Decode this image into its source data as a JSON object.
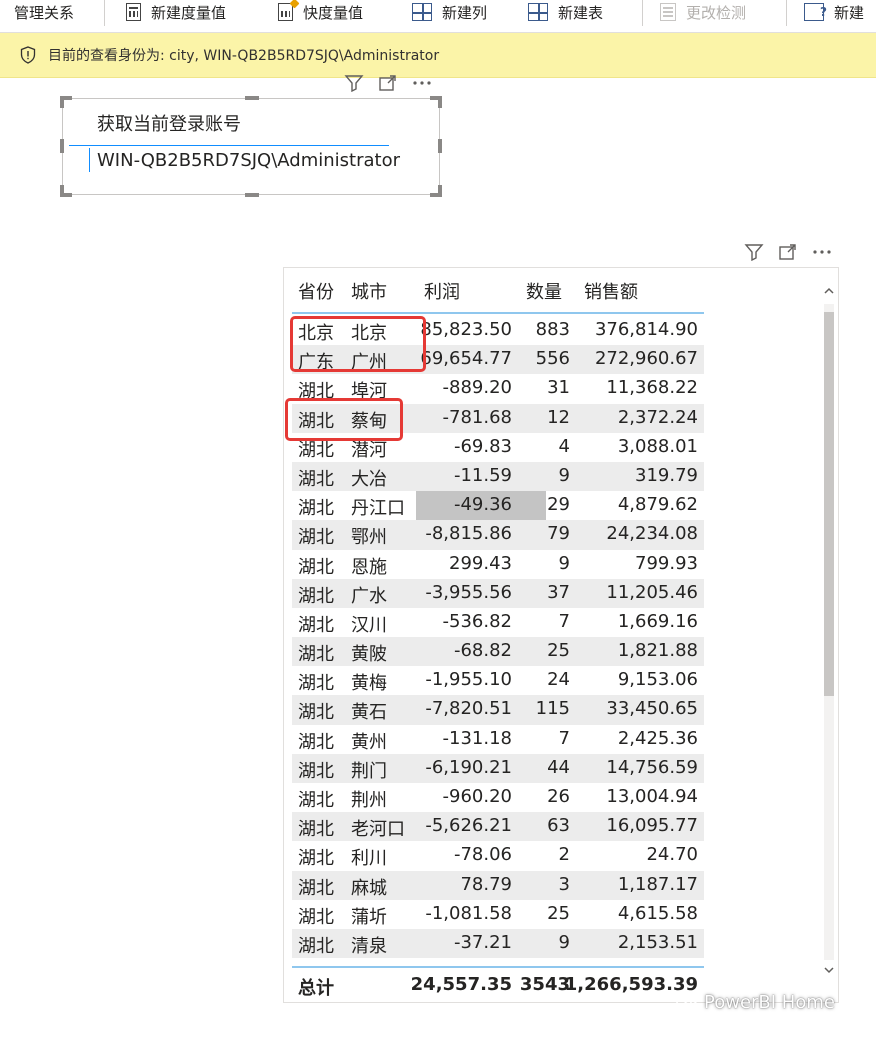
{
  "ribbon": {
    "items": [
      {
        "label": "管理关系",
        "icon": "manage-relationships-icon"
      },
      {
        "label": "新建度量值",
        "icon": "new-measure-icon"
      },
      {
        "label": "快度量值",
        "icon": "quick-measure-icon"
      },
      {
        "label": "新建列",
        "icon": "new-column-icon"
      },
      {
        "label": "新建表",
        "icon": "new-table-icon"
      },
      {
        "label": "更改检测",
        "icon": "change-detection-icon",
        "disabled": true
      },
      {
        "label": "新建",
        "icon": "new-parameter-icon"
      }
    ]
  },
  "notification": {
    "text": "目前的查看身份为: city, WIN-QB2B5RD7SJQ\\Administrator"
  },
  "card": {
    "title": "获取当前登录账号",
    "value": "WIN-QB2B5RD7SJQ\\Administrator"
  },
  "table": {
    "headers": {
      "province": "省份",
      "city": "城市",
      "profit": "利润",
      "quantity": "数量",
      "sales": "销售额"
    },
    "rows": [
      {
        "province": "北京",
        "city": "北京",
        "profit": "85,823.50",
        "quantity": "883",
        "sales": "376,814.90"
      },
      {
        "province": "广东",
        "city": "广州",
        "profit": "69,654.77",
        "quantity": "556",
        "sales": "272,960.67"
      },
      {
        "province": "湖北",
        "city": "埠河",
        "profit": "-889.20",
        "quantity": "31",
        "sales": "11,368.22"
      },
      {
        "province": "湖北",
        "city": "蔡甸",
        "profit": "-781.68",
        "quantity": "12",
        "sales": "2,372.24"
      },
      {
        "province": "湖北",
        "city": "潜河",
        "profit": "-69.83",
        "quantity": "4",
        "sales": "3,088.01"
      },
      {
        "province": "湖北",
        "city": "大冶",
        "profit": "-11.59",
        "quantity": "9",
        "sales": "319.79"
      },
      {
        "province": "湖北",
        "city": "丹江口",
        "profit": "-49.36",
        "quantity": "29",
        "sales": "4,879.62"
      },
      {
        "province": "湖北",
        "city": "鄂州",
        "profit": "-8,815.86",
        "quantity": "79",
        "sales": "24,234.08"
      },
      {
        "province": "湖北",
        "city": "恩施",
        "profit": "299.43",
        "quantity": "9",
        "sales": "799.93"
      },
      {
        "province": "湖北",
        "city": "广水",
        "profit": "-3,955.56",
        "quantity": "37",
        "sales": "11,205.46"
      },
      {
        "province": "湖北",
        "city": "汉川",
        "profit": "-536.82",
        "quantity": "7",
        "sales": "1,669.16"
      },
      {
        "province": "湖北",
        "city": "黄陂",
        "profit": "-68.82",
        "quantity": "25",
        "sales": "1,821.88"
      },
      {
        "province": "湖北",
        "city": "黄梅",
        "profit": "-1,955.10",
        "quantity": "24",
        "sales": "9,153.06"
      },
      {
        "province": "湖北",
        "city": "黄石",
        "profit": "-7,820.51",
        "quantity": "115",
        "sales": "33,450.65"
      },
      {
        "province": "湖北",
        "city": "黄州",
        "profit": "-131.18",
        "quantity": "7",
        "sales": "2,425.36"
      },
      {
        "province": "湖北",
        "city": "荆门",
        "profit": "-6,190.21",
        "quantity": "44",
        "sales": "14,756.59"
      },
      {
        "province": "湖北",
        "city": "荆州",
        "profit": "-960.20",
        "quantity": "26",
        "sales": "13,004.94"
      },
      {
        "province": "湖北",
        "city": "老河口",
        "profit": "-5,626.21",
        "quantity": "63",
        "sales": "16,095.77"
      },
      {
        "province": "湖北",
        "city": "利川",
        "profit": "-78.06",
        "quantity": "2",
        "sales": "24.70"
      },
      {
        "province": "湖北",
        "city": "麻城",
        "profit": "78.79",
        "quantity": "3",
        "sales": "1,187.17"
      },
      {
        "province": "湖北",
        "city": "蒲圻",
        "profit": "-1,081.58",
        "quantity": "25",
        "sales": "4,615.58"
      },
      {
        "province": "湖北",
        "city": "清泉",
        "profit": "-37.21",
        "quantity": "9",
        "sales": "2,153.51"
      }
    ],
    "totals": {
      "label": "总计",
      "profit": "24,557.35",
      "quantity": "3543",
      "sales": "1,266,593.39"
    }
  },
  "watermark": {
    "text": "PowerBI Home"
  },
  "colors": {
    "accent": "#118dff",
    "notify_bg": "#fbf4a8",
    "annotation": "#e53935",
    "row_band": "#ececec"
  }
}
